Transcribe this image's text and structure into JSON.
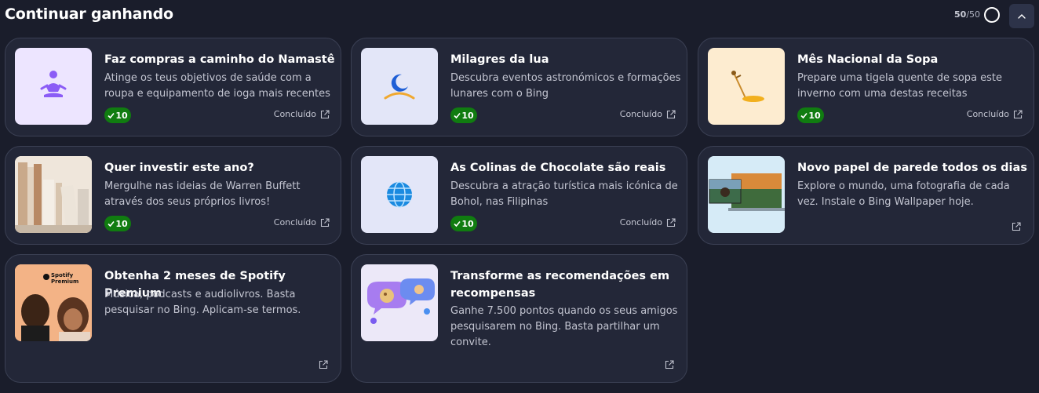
{
  "header": {
    "title": "Continuar ganhando",
    "progress_done": "50",
    "progress_total": "/50"
  },
  "cards": [
    {
      "title": "Faz compras a caminho do Namastê",
      "description": "Atinge os teus objetivos de saúde com a roupa e equipamento de ioga mais recentes",
      "points": "10",
      "status": "Concluído"
    },
    {
      "title": "Milagres da lua",
      "description": "Descubra eventos astronómicos e formações lunares com o Bing",
      "points": "10",
      "status": "Concluído"
    },
    {
      "title": "Mês Nacional da Sopa",
      "description": "Prepare uma tigela quente de sopa este inverno com uma destas receitas",
      "points": "10",
      "status": "Concluído"
    },
    {
      "title": "Quer investir este ano?",
      "description": "Mergulhe nas ideias de Warren Buffett através dos seus próprios livros!",
      "points": "10",
      "status": "Concluído"
    },
    {
      "title": "As Colinas de Chocolate são reais",
      "description": "Descubra a atração turística mais icónica de Bohol, nas Filipinas",
      "points": "10",
      "status": "Concluído"
    },
    {
      "title": "Novo papel de parede todos os dias",
      "description": "Explore o mundo, uma fotografia de cada vez. Instale o Bing Wallpaper hoje."
    },
    {
      "title": "Obtenha 2 meses de Spotify Premium",
      "description": "Música, podcasts e audiolivros. Basta pesquisar no Bing. Aplicam-se termos.",
      "image_text": "Spotify Premium"
    },
    {
      "title": "Transforme as recomendações em recompensas",
      "description": "Ganhe 7.500 pontos quando os seus amigos pesquisarem no Bing. Basta partilhar um convite."
    }
  ]
}
